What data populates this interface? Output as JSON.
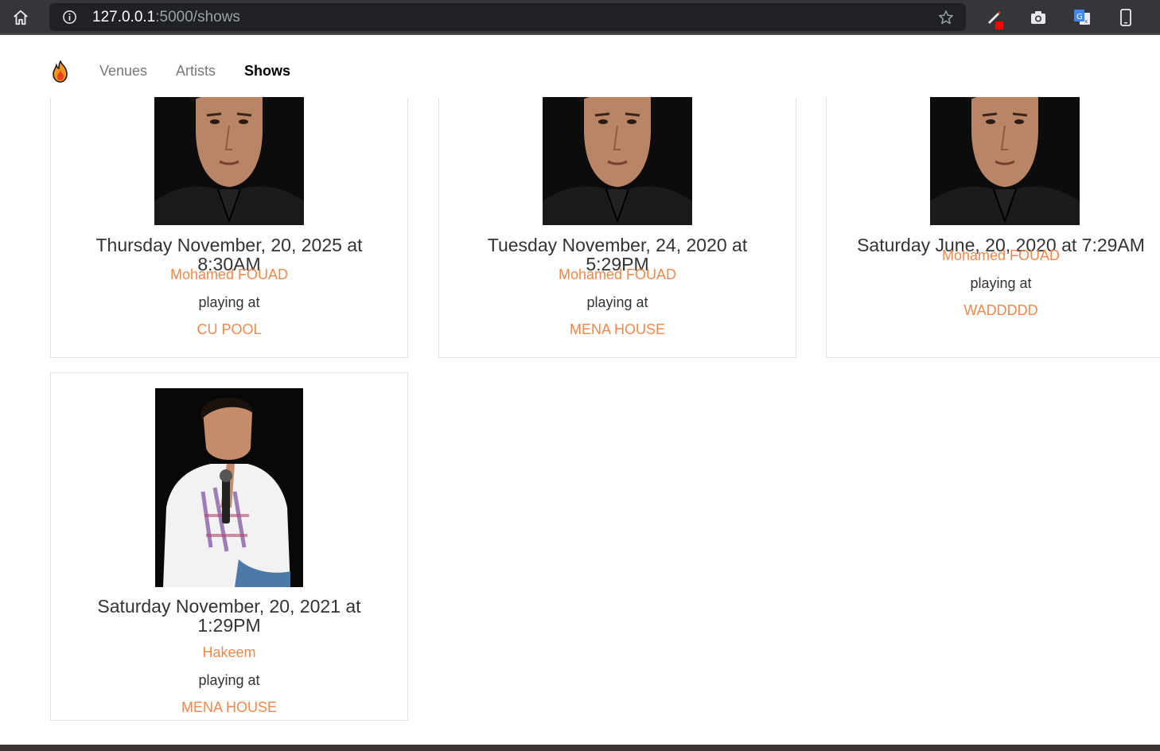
{
  "browser": {
    "url_host": "127.0.0.1",
    "url_rest": ":5000/shows"
  },
  "nav": {
    "logo_icon": "flame-icon",
    "venues_label": "Venues",
    "artists_label": "Artists",
    "shows_label": "Shows"
  },
  "shows": [
    {
      "when": "Thursday November, 20, 2025 at 8:30AM",
      "artist": "Mohamed FOUAD",
      "playing": "playing at",
      "venue": "CU POOL"
    },
    {
      "when": "Tuesday November, 24, 2020 at 5:29PM",
      "artist": "Mohamed FOUAD",
      "playing": "playing at",
      "venue": "MENA HOUSE"
    },
    {
      "when": "Saturday June, 20, 2020 at 7:29AM",
      "artist": "Mohamed FOUAD",
      "playing": "playing at",
      "venue": "WADDDDD"
    },
    {
      "when": "Saturday November, 20, 2021 at 1:29PM",
      "artist": "Hakeem",
      "playing": "playing at",
      "venue": "MENA HOUSE"
    }
  ],
  "colors": {
    "accent": "#f0884c",
    "chrome_bg": "#35363a",
    "omnibox_bg": "#202124"
  }
}
